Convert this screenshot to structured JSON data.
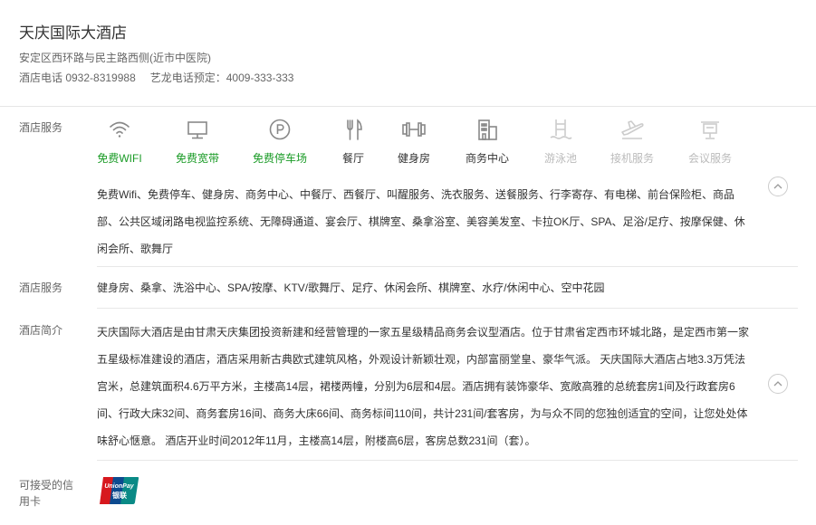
{
  "hotel": {
    "name": "天庆国际大酒店",
    "address": "安定区西环路与民主路西侧(近市中医院)",
    "phone_label": "酒店电话 0932-8319988",
    "booking_label": "艺龙电话预定：4009-333-333"
  },
  "facilities": {
    "label": "酒店服务",
    "items": [
      {
        "label": "免费WIFI",
        "icon": "wifi-icon",
        "state": "highlight"
      },
      {
        "label": "免费宽带",
        "icon": "monitor-icon",
        "state": "highlight"
      },
      {
        "label": "免费停车场",
        "icon": "parking-icon",
        "state": "highlight"
      },
      {
        "label": "餐厅",
        "icon": "fork-knife-icon",
        "state": "available"
      },
      {
        "label": "健身房",
        "icon": "dumbbell-icon",
        "state": "available"
      },
      {
        "label": "商务中心",
        "icon": "building-icon",
        "state": "available"
      },
      {
        "label": "游泳池",
        "icon": "pool-icon",
        "state": "unavailable"
      },
      {
        "label": "接机服务",
        "icon": "airplane-icon",
        "state": "unavailable"
      },
      {
        "label": "会议服务",
        "icon": "meeting-icon",
        "state": "unavailable"
      }
    ],
    "services_text": "免费Wifi、免费停车、健身房、商务中心、中餐厅、西餐厅、叫醒服务、洗衣服务、送餐服务、行李寄存、有电梯、前台保险柜、商品部、公共区域闭路电视监控系统、无障碍通道、宴会厅、棋牌室、桑拿浴室、美容美发室、卡拉OK厅、SPA、足浴/足疗、按摩保健、休闲会所、歌舞厅"
  },
  "services2": {
    "label": "酒店服务",
    "text": "健身房、桑拿、洗浴中心、SPA/按摩、KTV/歌舞厅、足疗、休闲会所、棋牌室、水疗/休闲中心、空中花园"
  },
  "intro": {
    "label": "酒店简介",
    "text": "天庆国际大酒店是由甘肃天庆集团投资新建和经营管理的一家五星级精品商务会议型酒店。位于甘肃省定西市环城北路，是定西市第一家五星级标准建设的酒店，酒店采用新古典欧式建筑风格，外观设计新颖壮观，内部富丽堂皇、豪华气派。 天庆国际大酒店占地3.3万凭法宫米，总建筑面积4.6万平方米，主楼高14层，裙楼两幢，分别为6层和4层。酒店拥有装饰豪华、宽敞高雅的总统套房1间及行政套房6间、行政大床32间、商务套房16间、商务大床66间、商务标间110间，共计231间/套客房，为与众不同的您独创适宜的空间，让您处处体味舒心惬意。  酒店开业时间2012年11月，主楼高14层，附楼高6层，客房总数231间（套）。"
  },
  "cards": {
    "label": "可接受的信用卡",
    "logo_text": "UnionPay",
    "logo_text_cn": "银联"
  },
  "colors": {
    "highlight": "#1a9b26",
    "unavailable": "#bbbbbb"
  }
}
